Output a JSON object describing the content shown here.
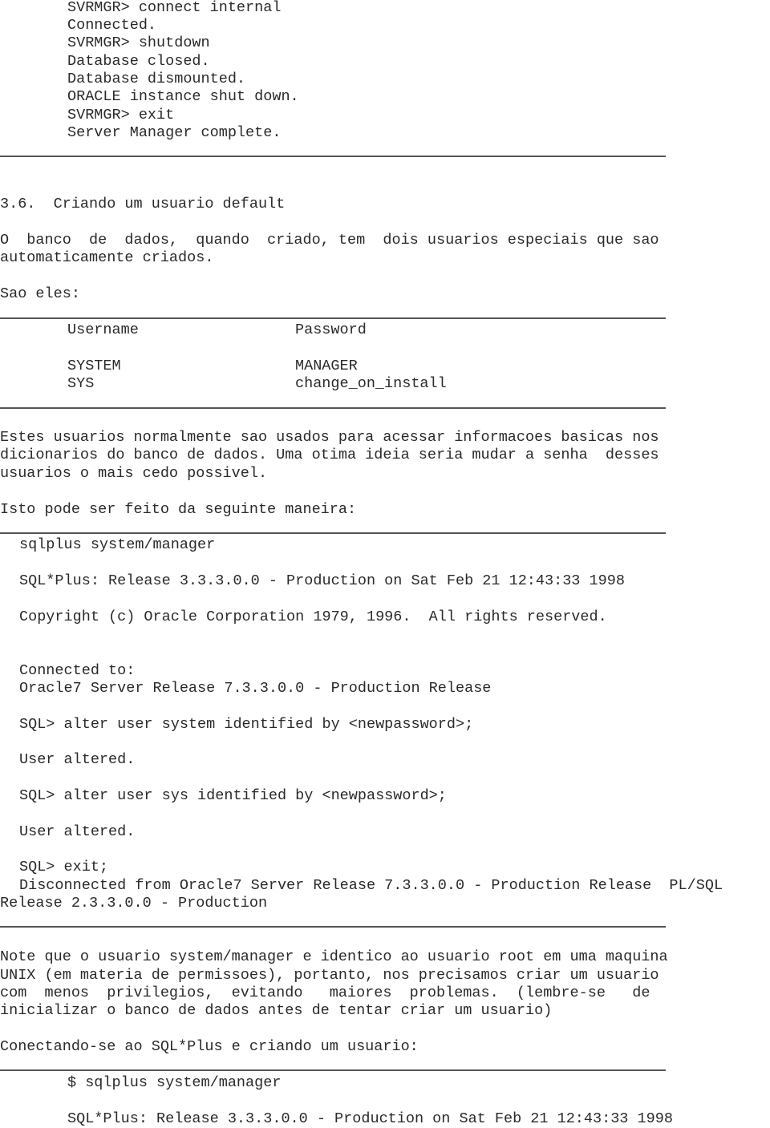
{
  "session1": [
    "SVRMGR> connect internal",
    "Connected.",
    "SVRMGR> shutdown",
    "Database closed.",
    "Database dismounted.",
    "ORACLE instance shut down.",
    "SVRMGR> exit",
    "Server Manager complete."
  ],
  "section": {
    "heading": "3.6.  Criando um usuario default",
    "intro": [
      "O  banco  de  dados,  quando  criado, tem  dois usuarios especiais que sao",
      "automaticamente criados."
    ],
    "sao_eles": "Sao eles:"
  },
  "users_table": {
    "headers": [
      "Username",
      "Password"
    ],
    "rows": [
      [
        "SYSTEM",
        "MANAGER"
      ],
      [
        "SYS",
        "change_on_install"
      ]
    ]
  },
  "paragraph2": [
    "Estes usuarios normalmente sao usados para acessar informacoes basicas nos",
    "dicionarios do banco de dados. Uma otima ideia seria mudar a senha  desses",
    "usuarios o mais cedo possivel."
  ],
  "howto": "Isto pode ser feito da seguinte maneira:",
  "session2": {
    "lines": [
      "sqlplus system/manager",
      "SQL*Plus: Release 3.3.3.0.0 - Production on Sat Feb 21 12:43:33 1998",
      "Copyright (c) Oracle Corporation 1979, 1996.  All rights reserved.",
      "Connected to:",
      "Oracle7 Server Release 7.3.3.0.0 - Production Release",
      "SQL> alter user system identified by <newpassword>;",
      "User altered.",
      "SQL> alter user sys identified by <newpassword>;",
      "User altered.",
      "SQL> exit;",
      "Disconnected from Oracle7 Server Release 7.3.3.0.0 - Production Release  PL/SQL"
    ],
    "wrap": "Release 2.3.3.0.0 - Production"
  },
  "paragraph3": [
    "Note que o usuario system/manager e identico ao usuario root em uma maquina",
    "UNIX (em materia de permissoes), portanto, nos precisamos criar um usuario",
    "com  menos  privilegios,  evitando   maiores  problemas.  (lembre-se   de",
    "inicializar o banco de dados antes de tentar criar um usuario)"
  ],
  "connecting": "Conectando-se ao SQL*Plus e criando um usuario:",
  "session3": [
    "$ sqlplus system/manager",
    "SQL*Plus: Release 3.3.3.0.0 - Production on Sat Feb 21 12:43:33 1998"
  ]
}
